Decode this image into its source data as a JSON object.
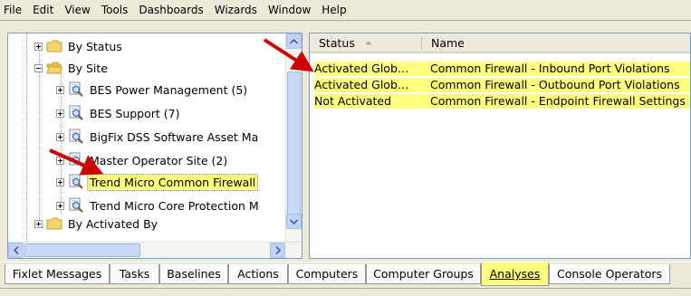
{
  "menu": [
    "File",
    "Edit",
    "View",
    "Tools",
    "Dashboards",
    "Wizards",
    "Window",
    "Help"
  ],
  "tree": [
    {
      "label": "By Status",
      "type": "folder",
      "expander": "plus"
    },
    {
      "label": "By Site",
      "type": "folder",
      "expander": "minus"
    },
    {
      "label": "BES Power Management (5)",
      "type": "site",
      "expander": "plus"
    },
    {
      "label": "BES Support (7)",
      "type": "site",
      "expander": "plus"
    },
    {
      "label": "BigFix DSS Software Asset Ma",
      "type": "site",
      "expander": "plus"
    },
    {
      "label": "Master Operator Site (2)",
      "type": "site",
      "expander": "plus"
    },
    {
      "label": "Trend Micro Common Firewall",
      "type": "site",
      "expander": "plus",
      "selected": true
    },
    {
      "label": "Trend Micro Core Protection M",
      "type": "site",
      "expander": "plus"
    },
    {
      "label": "By Activated By",
      "type": "folder",
      "expander": "plus"
    }
  ],
  "list": {
    "columns": [
      "Status",
      "Name"
    ],
    "rows": [
      {
        "status": "Activated Glob…",
        "name": "Common Firewall - Inbound Port Violations"
      },
      {
        "status": "Activated Glob…",
        "name": "Common Firewall - Outbound Port Violations"
      },
      {
        "status": "Not Activated",
        "name": "Common Firewall - Endpoint Firewall Settings"
      }
    ]
  },
  "tabs": [
    "Fixlet Messages",
    "Tasks",
    "Baselines",
    "Actions",
    "Computers",
    "Computer Groups",
    "Analyses",
    "Console Operators"
  ],
  "active_tab": "Analyses",
  "colors": {
    "highlight": "#ffff80",
    "arrow": "#cc0000",
    "folder": "#f5d56b",
    "chrome": "#ece9d8"
  },
  "icons": {
    "folder": "folder-icon",
    "site": "site-magnifier-icon",
    "arrow": "red-arrow-annotation",
    "sort": "sort-ascending-icon"
  }
}
